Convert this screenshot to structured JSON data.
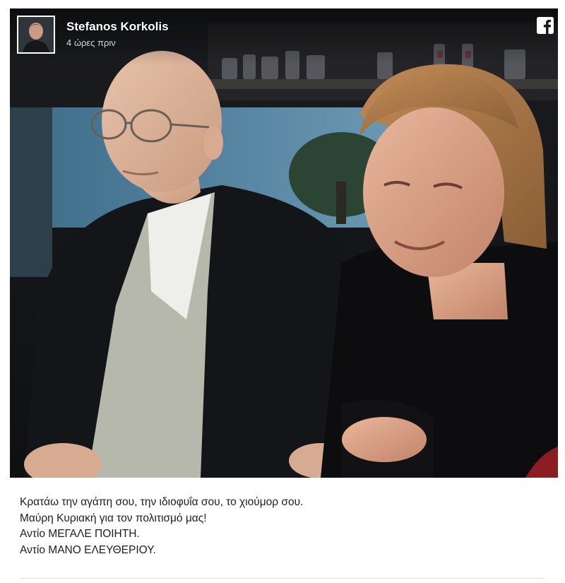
{
  "post": {
    "author_name": "Stefanos Korkolis",
    "timestamp": "4 ώρες πριν",
    "platform_icon": "facebook-icon",
    "caption_lines": [
      "Κρατάω την αγάπη σου, την ιδιοφυΐα σου, το χιούμορ σου.",
      "Μαύρη Κυριακή για τον πολιτισμό μας!",
      "Αντίο ΜΕΓΑΛΕ ΠΟΙΗΤΗ.",
      "Αντίο ΜΑΝΟ ΕΛΕΥΘΕΡΙΟΥ."
    ]
  },
  "colors": {
    "background": "#ffffff",
    "caption_text": "#1c1e21",
    "header_text": "#ffffff",
    "facebook_brand": "#3b5998"
  }
}
